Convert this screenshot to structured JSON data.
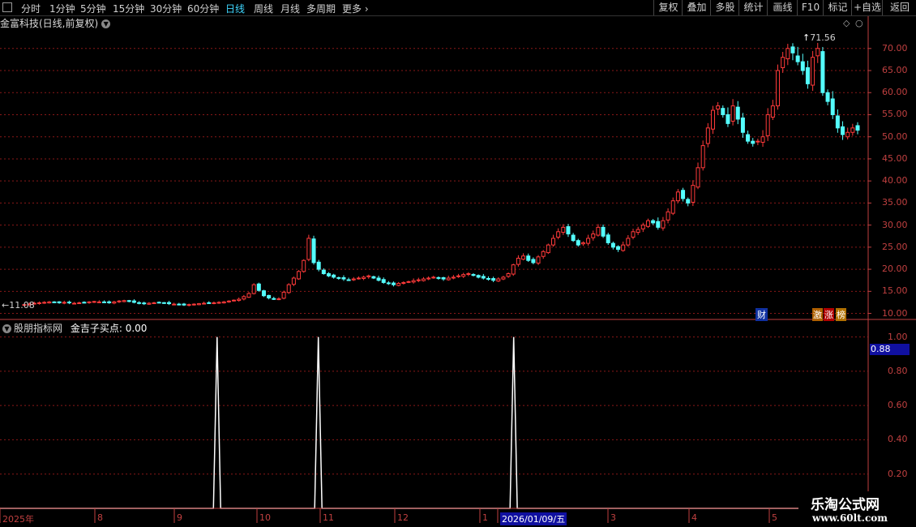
{
  "toolbar": {
    "left_items": [
      "分时",
      "1分钟",
      "5分钟",
      "15分钟",
      "30分钟",
      "60分钟",
      "日线",
      "周线",
      "月线",
      "多周期",
      "更多"
    ],
    "active_item": "日线",
    "right_items": [
      "复权",
      "叠加",
      "多股",
      "统计",
      "画线",
      "F10",
      "标记",
      "+自选",
      "返回"
    ]
  },
  "chart_title": "金富科技(日线,前复权)",
  "lower_title": "股朋指标网",
  "indicator_label": "金吉子买点: 0.00",
  "markers": {
    "cai": "财",
    "zhang": "涨",
    "bang": "榜",
    "ji": "激"
  },
  "price_labels": {
    "high": "71.56",
    "low": "11.08",
    "low_prefix": "←"
  },
  "lower_value_box": "0.88",
  "colors": {
    "up": "#ff3a3a",
    "down": "#54ffff",
    "grid": "#8a1818",
    "axis": "#c04040",
    "indicator": "#ffffff"
  },
  "chart_data": [
    {
      "type": "candlestick",
      "title": "金富科技(日线,前复权)",
      "y_axis_ticks": [
        "70.00",
        "65.00",
        "60.00",
        "55.00",
        "50.00",
        "45.00",
        "40.00",
        "35.00",
        "30.00",
        "25.00",
        "20.00",
        "15.00",
        "10.00"
      ],
      "ylim": [
        9,
        74
      ],
      "x_labels": [
        "2025年",
        "8",
        "9",
        "10",
        "11",
        "12",
        "1",
        "2026/01/09/五",
        "3",
        "4",
        "5"
      ],
      "high": 71.56,
      "low": 11.08,
      "closes": [
        12,
        12.1,
        12.3,
        12.4,
        12.5,
        12.6,
        12.5,
        12.4,
        12.5,
        12.4,
        12.3,
        12.4,
        12.5,
        12.6,
        12.7,
        12.6,
        12.5,
        12.4,
        12.6,
        12.8,
        12.9,
        12.7,
        12.5,
        12.3,
        12.2,
        12.3,
        12.4,
        12.5,
        12.4,
        12.2,
        12.1,
        12.0,
        11.9,
        12.0,
        12.1,
        12.2,
        12.3,
        12.4,
        12.4,
        12.5,
        12.6,
        12.8,
        13.0,
        13.2,
        13.8,
        14.5,
        16.5,
        15.2,
        14.0,
        13.5,
        13.2,
        13.3,
        14.8,
        16.5,
        18.0,
        19.5,
        22.0,
        27.0,
        21.5,
        20.0,
        19.0,
        18.5,
        18.2,
        18.0,
        17.8,
        17.6,
        17.8,
        18.0,
        18.2,
        18.5,
        18.0,
        17.5,
        17.0,
        16.8,
        16.5,
        16.8,
        17.0,
        17.2,
        17.4,
        17.6,
        17.8,
        18.0,
        18.2,
        18.0,
        17.8,
        18.0,
        18.2,
        18.5,
        18.8,
        19.0,
        18.6,
        18.2,
        18.0,
        17.8,
        17.5,
        17.8,
        18.2,
        19.0,
        21.0,
        22.5,
        23.0,
        22.0,
        21.5,
        22.8,
        24.0,
        25.5,
        27.0,
        28.5,
        29.5,
        28.0,
        26.5,
        25.5,
        26.0,
        27.0,
        28.0,
        29.5,
        27.5,
        26.0,
        25.0,
        24.5,
        25.5,
        27.0,
        28.5,
        29.0,
        30.0,
        31.0,
        30.5,
        29.5,
        31.0,
        33.0,
        35.5,
        37.5,
        36.0,
        35.0,
        39.0,
        43.0,
        48.0,
        52.0,
        56.0,
        57.0,
        55.0,
        53.0,
        57.0,
        54.0,
        51.0,
        49.0,
        48.5,
        49.0,
        50.0,
        55.0,
        57.0,
        65.0,
        68.0,
        70.0,
        69.0,
        67.0,
        65.0,
        62.0,
        68.0,
        70.0,
        60.0,
        58.0,
        55.0,
        52.0,
        50.5,
        51.0,
        52.0,
        51.5
      ]
    },
    {
      "type": "line",
      "title": "金吉子买点",
      "y_axis_ticks": [
        "1.00",
        "0.80",
        "0.60",
        "0.40",
        "0.20"
      ],
      "ylim": [
        0,
        1.05
      ],
      "signal_days": [
        60,
        88,
        142
      ],
      "total_days": 240,
      "values_description": "0 everywhere except spikes to 1.00 on signal days"
    }
  ]
}
